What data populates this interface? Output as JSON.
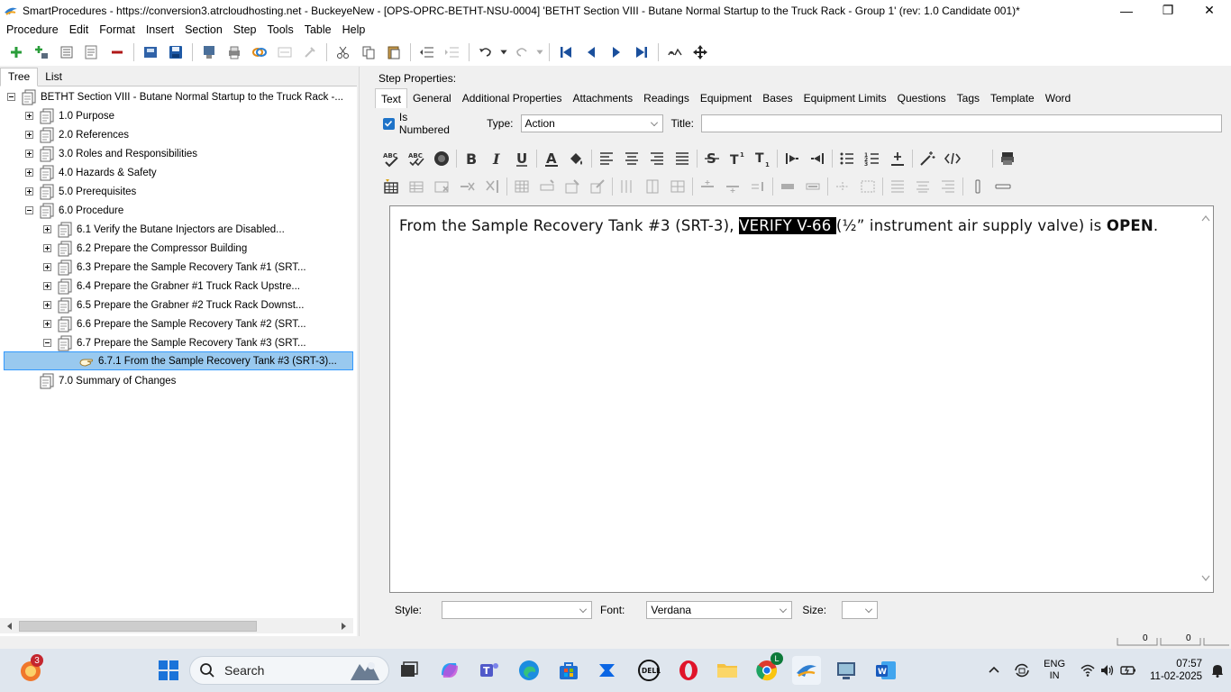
{
  "window": {
    "title": "SmartProcedures - https://conversion3.atrcloudhosting.net - BuckeyeNew - [OPS-OPRC-BETHT-NSU-0004] 'BETHT Section VIII - Butane Normal Startup to the Truck Rack - Group 1' (rev: 1.0 Candidate 001)*",
    "minimize": "—",
    "maximize": "❐",
    "close": "✕"
  },
  "menu": [
    "Procedure",
    "Edit",
    "Format",
    "Insert",
    "Section",
    "Step",
    "Tools",
    "Table",
    "Help"
  ],
  "left": {
    "tabs": [
      "Tree",
      "List"
    ],
    "active_tab": "Tree",
    "tree": [
      {
        "label": "BETHT Section VIII - Butane Normal Startup to the Truck Rack -...",
        "level": 0,
        "expander": "minus"
      },
      {
        "label": "1.0 Purpose",
        "level": 1,
        "expander": "plus"
      },
      {
        "label": "2.0 References",
        "level": 1,
        "expander": "plus"
      },
      {
        "label": "3.0 Roles and Responsibilities",
        "level": 1,
        "expander": "plus"
      },
      {
        "label": "4.0 Hazards & Safety",
        "level": 1,
        "expander": "plus"
      },
      {
        "label": "5.0 Prerequisites",
        "level": 1,
        "expander": "plus"
      },
      {
        "label": "6.0 Procedure",
        "level": 1,
        "expander": "minus"
      },
      {
        "label": "6.1 Verify the Butane Injectors are Disabled...",
        "level": 2,
        "expander": "plus"
      },
      {
        "label": "6.2 Prepare the Compressor Building",
        "level": 2,
        "expander": "plus"
      },
      {
        "label": "6.3 Prepare the Sample Recovery Tank #1 (SRT...",
        "level": 2,
        "expander": "plus"
      },
      {
        "label": "6.4 Prepare the Grabner #1 Truck Rack Upstre...",
        "level": 2,
        "expander": "plus"
      },
      {
        "label": "6.5 Prepare the Grabner #2 Truck Rack Downst...",
        "level": 2,
        "expander": "plus"
      },
      {
        "label": "6.6 Prepare the Sample Recovery Tank #2 (SRT...",
        "level": 2,
        "expander": "plus"
      },
      {
        "label": "6.7 Prepare the Sample Recovery Tank #3 (SRT...",
        "level": 2,
        "expander": "minus"
      },
      {
        "label": "6.7.1 From the Sample Recovery Tank #3 (SRT-3)...",
        "level": 3,
        "expander": "none",
        "selected": true
      },
      {
        "label": "7.0 Summary of Changes",
        "level": 1,
        "expander": "none"
      }
    ]
  },
  "right": {
    "heading": "Step Properties:",
    "tabs": [
      "Text",
      "General",
      "Additional Properties",
      "Attachments",
      "Readings",
      "Equipment",
      "Bases",
      "Equipment Limits",
      "Questions",
      "Tags",
      "Template",
      "Word"
    ],
    "active_tab": "Text",
    "is_numbered_label": "Is Numbered",
    "is_numbered_checked": true,
    "type_label": "Type:",
    "type_value": "Action",
    "title_label": "Title:",
    "title_value": "",
    "editor": {
      "pre": "From the Sample Recovery Tank #3 (SRT-3), ",
      "highlight": "VERIFY V-66 ",
      "mid": "(½” instrument air supply valve) is ",
      "bold": "OPEN",
      "post": "."
    },
    "style_label": "Style:",
    "style_value": "",
    "font_label": "Font:",
    "font_value": "Verdana",
    "size_label": "Size:",
    "size_value": ""
  },
  "status_bits": [
    "0",
    "0"
  ],
  "taskbar": {
    "search_placeholder": "Search",
    "notification_count": "3",
    "chrome_badge": "L",
    "lang_top": "ENG",
    "lang_bottom": "IN",
    "time": "07:57",
    "date": "11-02-2025"
  },
  "colors": {
    "selection": "#99c9ef",
    "checkbox": "#1e73c8",
    "taskbar": "#dfe6ee"
  }
}
